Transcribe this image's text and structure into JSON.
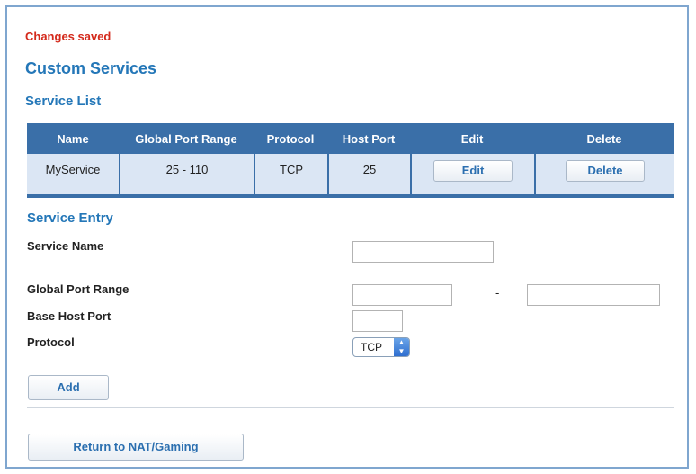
{
  "status": "Changes saved",
  "title": "Custom Services",
  "service_list": {
    "heading": "Service List",
    "columns": [
      "Name",
      "Global Port Range",
      "Protocol",
      "Host Port",
      "Edit",
      "Delete"
    ],
    "rows": [
      {
        "name": "MyService",
        "global_port_range": "25 - 110",
        "protocol": "TCP",
        "host_port": "25",
        "edit_label": "Edit",
        "delete_label": "Delete"
      }
    ]
  },
  "service_entry": {
    "heading": "Service Entry",
    "service_name_label": "Service Name",
    "service_name_value": "",
    "global_port_range_label": "Global Port Range",
    "global_port_start_value": "",
    "range_separator": "-",
    "global_port_end_value": "",
    "base_host_port_label": "Base Host Port",
    "base_host_port_value": "",
    "protocol_label": "Protocol",
    "protocol_selected": "TCP",
    "add_label": "Add"
  },
  "return_label": "Return to NAT/Gaming",
  "colors": {
    "accent": "#2477b8",
    "status": "#d42a1c",
    "table_header": "#3a6fa8",
    "table_row": "#dbe6f4"
  },
  "icons": {
    "select_arrows": "up-down-arrows-icon"
  }
}
